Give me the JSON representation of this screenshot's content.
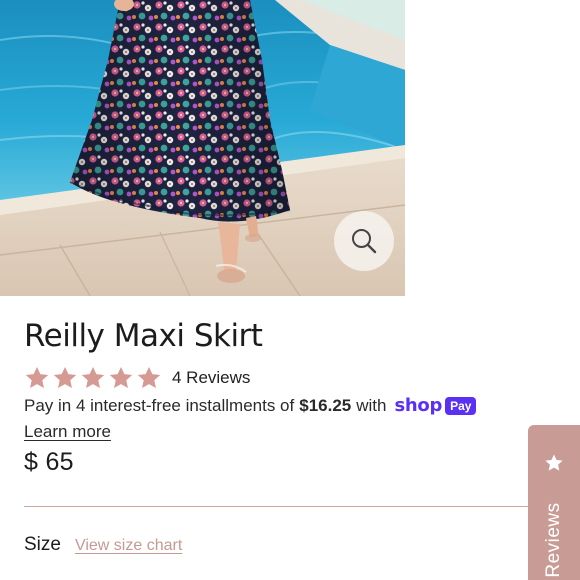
{
  "product": {
    "title": "Reilly Maxi Skirt",
    "rating_stars": 5,
    "review_count_label": "4 Reviews",
    "installments": {
      "prefix": "Pay in 4 interest-free installments of",
      "amount": "$16.25",
      "suffix": "with",
      "provider_word": "shop",
      "provider_badge": "Pay",
      "learn_more": "Learn more"
    },
    "price": "$ 65",
    "size_label": "Size",
    "size_chart_link": "View size chart"
  },
  "reviews_tab": {
    "label": "Reviews"
  },
  "icons": {
    "zoom": "magnifier-icon",
    "star": "star-icon"
  },
  "colors": {
    "star": "#d49a93",
    "accent": "#c99b95",
    "shop_pay": "#5a31f4",
    "link": "#c49a93"
  }
}
